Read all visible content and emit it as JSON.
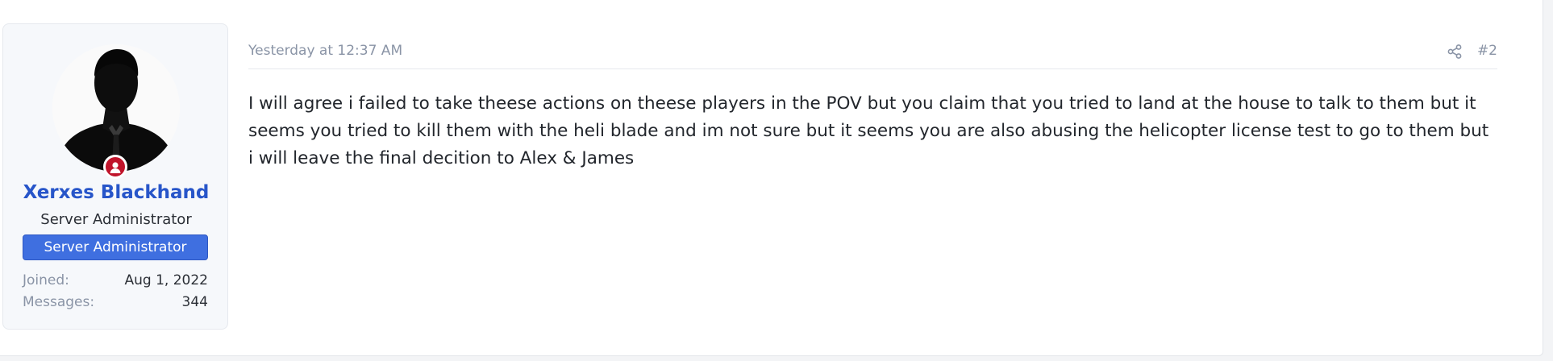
{
  "user": {
    "name": "Xerxes Blackhand",
    "title": "Server Administrator",
    "banner": "Server Administrator",
    "stats": [
      {
        "label": "Joined:",
        "value": "Aug 1, 2022"
      },
      {
        "label": "Messages:",
        "value": "344"
      }
    ],
    "avatar_icon": "silhouette-avatar",
    "status_icon": "user-circle-icon",
    "status_color": "#c0142b"
  },
  "post": {
    "date": "Yesterday at 12:37 AM",
    "share_icon": "share-icon",
    "number": "#2",
    "message": "I will agree i failed to take theese actions on theese players in the POV but you claim that you tried to land at the house to talk to them but it seems you tried to kill them with the heli blade and im not sure but it seems you are also abusing the helicopter license test to go to them but i will leave the final decition to Alex & James"
  },
  "colors": {
    "username": "#2755c9",
    "banner_bg": "#3f6fe0",
    "muted": "#8a94a6"
  }
}
